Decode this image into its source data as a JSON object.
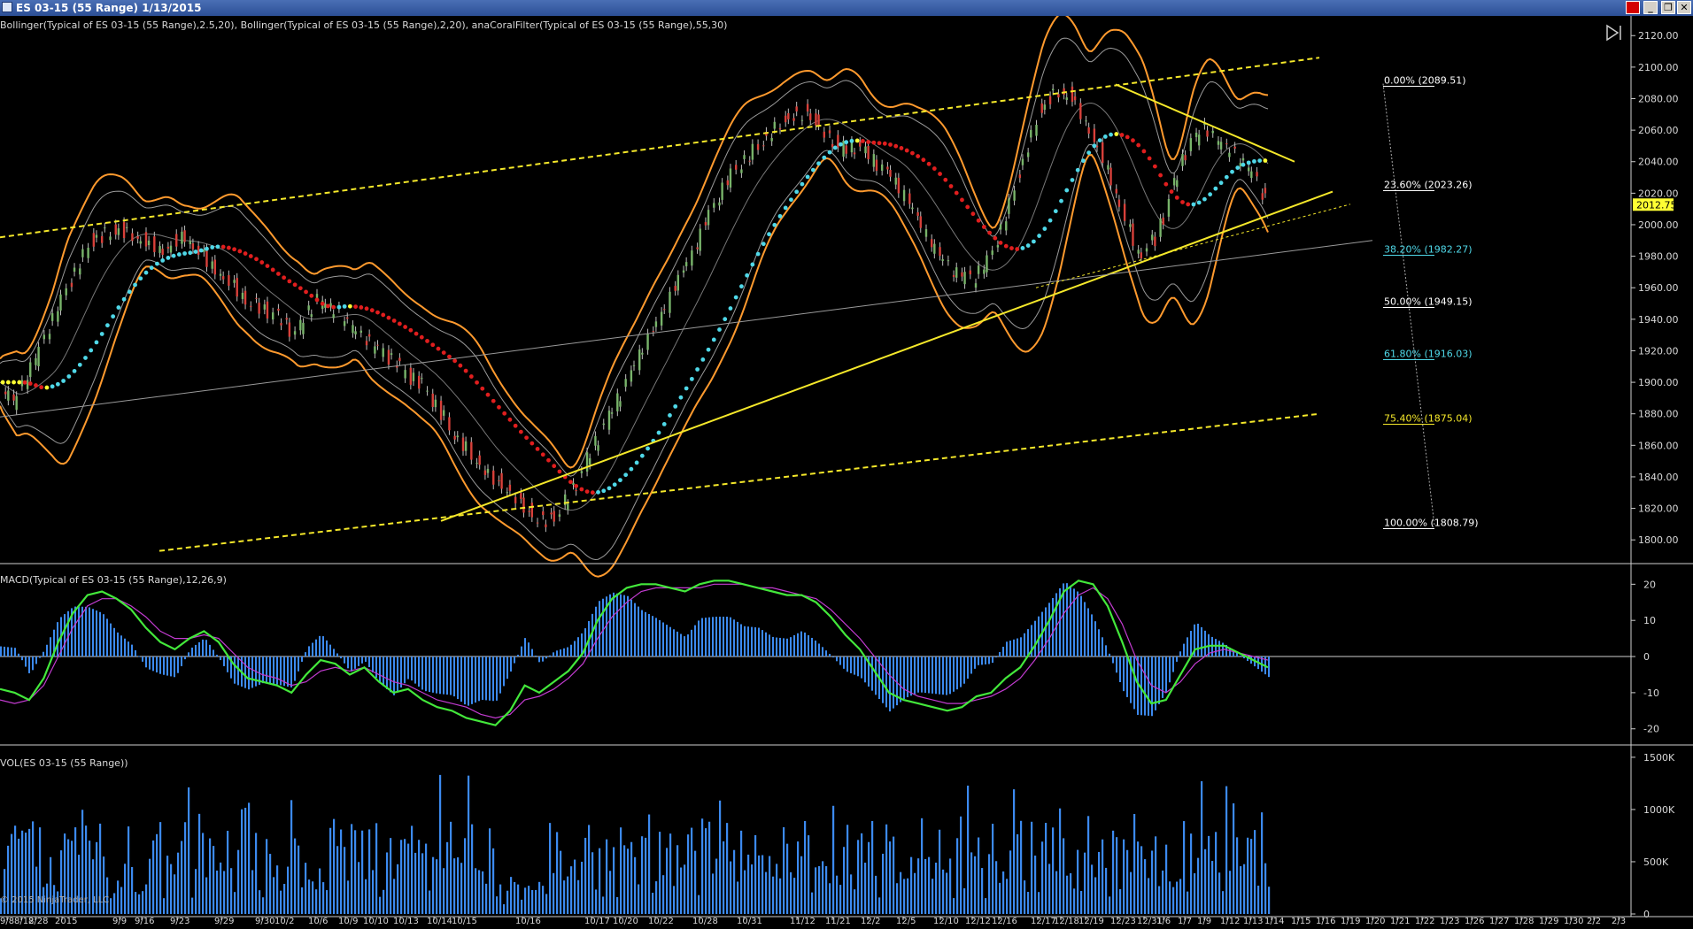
{
  "window": {
    "title": "ES 03-15 (55 Range)  1/13/2015",
    "close_label": "✕",
    "restore_label": "❐",
    "minimize_label": "_"
  },
  "panels": {
    "price_label": "Bollinger(Typical of ES 03-15 (55 Range),2.5,20), Bollinger(Typical of ES 03-15 (55 Range),2,20), anaCoralFilter(Typical of ES 03-15 (55 Range),55,30)",
    "macd_label": "MACD(Typical of ES 03-15 (55 Range),12,26,9)",
    "volume_label": "VOL(ES 03-15 (55 Range))",
    "copyright": "© 2015 NinjaTrader, LLC"
  },
  "colors": {
    "background": "#000000",
    "bollinger_outer": "#ff9a2e",
    "bollinger_inner": "#9a9a9a",
    "coral_up": "#4fd8e8",
    "coral_down": "#e01e1e",
    "coral_flat": "#ffff33",
    "channel": "#f5e82a",
    "candle_up": "#78b46a",
    "candle_down": "#d8403a",
    "macd_line": "#43e83b",
    "signal_line": "#c23bd0",
    "histogram": "#3c8af0",
    "volume": "#3c8af0",
    "last_price_box": "#ffff33"
  },
  "chart_data": [
    {
      "type": "line",
      "title": "",
      "series_name": "ES 03-15 (55 Range)",
      "ylim": [
        1790,
        2128
      ],
      "y_ticks": [
        1800,
        1820,
        1840,
        1860,
        1880,
        1900,
        1920,
        1940,
        1960,
        1980,
        2000,
        2020,
        2040,
        2060,
        2080,
        2100,
        2120
      ],
      "last_price": "2012.75",
      "bar_count": 290,
      "price_path": [
        [
          0,
          1900
        ],
        [
          6,
          1886
        ],
        [
          14,
          1915
        ],
        [
          24,
          1955
        ],
        [
          34,
          1990
        ],
        [
          44,
          1998
        ],
        [
          52,
          1992
        ],
        [
          60,
          1985
        ],
        [
          68,
          1994
        ],
        [
          76,
          1978
        ],
        [
          84,
          1965
        ],
        [
          92,
          1950
        ],
        [
          100,
          1944
        ],
        [
          108,
          1930
        ],
        [
          116,
          1952
        ],
        [
          124,
          1942
        ],
        [
          132,
          1928
        ],
        [
          140,
          1918
        ],
        [
          148,
          1906
        ],
        [
          156,
          1895
        ],
        [
          164,
          1872
        ],
        [
          172,
          1855
        ],
        [
          180,
          1840
        ],
        [
          186,
          1832
        ],
        [
          192,
          1820
        ],
        [
          198,
          1812
        ],
        [
          204,
          1818
        ],
        [
          210,
          1836
        ],
        [
          216,
          1858
        ],
        [
          222,
          1878
        ],
        [
          228,
          1898
        ],
        [
          234,
          1920
        ],
        [
          240,
          1938
        ],
        [
          246,
          1960
        ],
        [
          252,
          1980
        ],
        [
          258,
          2005
        ],
        [
          264,
          2026
        ],
        [
          270,
          2040
        ],
        [
          276,
          2050
        ],
        [
          282,
          2062
        ],
        [
          288,
          2070
        ],
        [
          294,
          2072
        ],
        [
          300,
          2060
        ],
        [
          306,
          2048
        ],
        [
          312,
          2050
        ],
        [
          318,
          2040
        ],
        [
          324,
          2030
        ],
        [
          330,
          2015
        ],
        [
          336,
          1995
        ],
        [
          342,
          1978
        ],
        [
          348,
          1968
        ],
        [
          354,
          1965
        ],
        [
          360,
          1978
        ],
        [
          366,
          2006
        ],
        [
          372,
          2040
        ],
        [
          378,
          2072
        ],
        [
          384,
          2086
        ],
        [
          390,
          2082
        ],
        [
          396,
          2062
        ],
        [
          402,
          2040
        ],
        [
          408,
          2010
        ],
        [
          414,
          1982
        ],
        [
          420,
          1990
        ],
        [
          426,
          2020
        ],
        [
          432,
          2050
        ],
        [
          438,
          2060
        ],
        [
          444,
          2050
        ],
        [
          450,
          2042
        ],
        [
          456,
          2030
        ],
        [
          460,
          2015
        ]
      ],
      "fibonacci": [
        {
          "label": "0.00% (2089.51)",
          "value": 2089.51,
          "color": "#ffffff"
        },
        {
          "label": "23.60% (2023.26)",
          "value": 2023.26,
          "color": "#ffffff"
        },
        {
          "label": "38.20% (1982.27)",
          "value": 1982.27,
          "color": "#4fd8e8"
        },
        {
          "label": "50.00% (1949.15)",
          "value": 1949.15,
          "color": "#ffffff"
        },
        {
          "label": "61.80% (1916.03)",
          "value": 1916.03,
          "color": "#4fd8e8"
        },
        {
          "label": "75.40% (1875.04)",
          "value": 1875.04,
          "color": "#f5e82a"
        },
        {
          "label": "100.00% (1808.79)",
          "value": 1808.79,
          "color": "#ffffff"
        }
      ],
      "trendlines": [
        {
          "name": "upper-channel",
          "from": [
            0,
            1992
          ],
          "to": [
            1490,
            2106
          ],
          "style": "dashed"
        },
        {
          "name": "lower-channel",
          "from": [
            180,
            1793
          ],
          "to": [
            1490,
            1880
          ],
          "style": "dashed"
        },
        {
          "name": "support-trendline",
          "from": [
            498,
            1812
          ],
          "to": [
            1505,
            2021
          ],
          "style": "solid"
        },
        {
          "name": "resistance-trendline",
          "from": [
            1260,
            2089
          ],
          "to": [
            1462,
            2040
          ],
          "style": "solid"
        },
        {
          "name": "mid-channel-grey",
          "from": [
            0,
            1878
          ],
          "to": [
            1550,
            1990
          ],
          "style": "thin"
        },
        {
          "name": "secondary-support",
          "from": [
            1170,
            1960
          ],
          "to": [
            1525,
            2013
          ],
          "style": "thin-dashed"
        }
      ]
    },
    {
      "type": "line",
      "title": "",
      "ylim": [
        -23,
        24
      ],
      "y_ticks": [
        20,
        10,
        0,
        -10,
        -20
      ],
      "series": [
        {
          "name": "MACD",
          "values": [
            -9,
            -10,
            -12,
            -6,
            4,
            12,
            17,
            18,
            16,
            13,
            8,
            4,
            2,
            5,
            7,
            4,
            -2,
            -6,
            -7,
            -8,
            -10,
            -5,
            -1,
            -2,
            -5,
            -3,
            -7,
            -10,
            -9,
            -12,
            -14,
            -15,
            -17,
            -18,
            -19,
            -15,
            -8,
            -10,
            -7,
            -4,
            1,
            10,
            16,
            19,
            20,
            20,
            19,
            18,
            20,
            21,
            21,
            20,
            19,
            18,
            17,
            17,
            15,
            11,
            6,
            2,
            -4,
            -10,
            -12,
            -13,
            -14,
            -15,
            -14,
            -11,
            -10,
            -6,
            -3,
            3,
            10,
            18,
            21,
            20,
            14,
            4,
            -7,
            -13,
            -12,
            -5,
            2,
            3,
            3,
            1,
            -1,
            -3
          ]
        },
        {
          "name": "Signal",
          "values": [
            -12,
            -13,
            -12,
            -8,
            0,
            8,
            14,
            16,
            16,
            14,
            11,
            7,
            5,
            5,
            6,
            5,
            1,
            -3,
            -5,
            -6,
            -8,
            -7,
            -4,
            -3,
            -4,
            -3,
            -5,
            -7,
            -8,
            -10,
            -12,
            -13,
            -14,
            -16,
            -17,
            -16,
            -12,
            -11,
            -9,
            -6,
            -2,
            5,
            11,
            15,
            18,
            19,
            19,
            19,
            19,
            20,
            20,
            20,
            19,
            19,
            18,
            17,
            16,
            13,
            9,
            5,
            0,
            -5,
            -9,
            -11,
            -12,
            -13,
            -13,
            -12,
            -11,
            -9,
            -6,
            -1,
            5,
            12,
            17,
            19,
            16,
            9,
            -1,
            -8,
            -10,
            -7,
            -2,
            1,
            2,
            1,
            0,
            -1
          ]
        }
      ],
      "histogram_scale": 0.42
    },
    {
      "type": "bar",
      "title": "",
      "ylim": [
        0,
        1550000
      ],
      "y_ticks": [
        {
          "value": 1500000,
          "label": "1500K"
        },
        {
          "value": 1000000,
          "label": "1000K"
        },
        {
          "value": 500000,
          "label": "500K"
        },
        {
          "value": 0,
          "label": "0"
        }
      ]
    }
  ],
  "x_axis": {
    "labels": [
      {
        "label": "9/8",
        "x": 8
      },
      {
        "label": "8/12",
        "x": 24
      },
      {
        "label": "8/28",
        "x": 40
      },
      {
        "label": "2015",
        "x": 70
      },
      {
        "label": "9/9",
        "x": 135
      },
      {
        "label": "9/16",
        "x": 160
      },
      {
        "label": "9/23",
        "x": 200
      },
      {
        "label": "9/29",
        "x": 250
      },
      {
        "label": "9/30",
        "x": 296
      },
      {
        "label": "10/2",
        "x": 318
      },
      {
        "label": "10/6",
        "x": 356
      },
      {
        "label": "10/9",
        "x": 390
      },
      {
        "label": "10/10",
        "x": 418
      },
      {
        "label": "10/13",
        "x": 452
      },
      {
        "label": "10/14",
        "x": 490
      },
      {
        "label": "10/15",
        "x": 518
      },
      {
        "label": "10/16",
        "x": 590
      },
      {
        "label": "10/17",
        "x": 668
      },
      {
        "label": "10/20",
        "x": 700
      },
      {
        "label": "10/22",
        "x": 740
      },
      {
        "label": "10/28",
        "x": 790
      },
      {
        "label": "10/31",
        "x": 840
      },
      {
        "label": "11/12",
        "x": 900
      },
      {
        "label": "11/21",
        "x": 940
      },
      {
        "label": "12/2",
        "x": 980
      },
      {
        "label": "12/5",
        "x": 1020
      },
      {
        "label": "12/10",
        "x": 1062
      },
      {
        "label": "12/12",
        "x": 1098
      },
      {
        "label": "12/16",
        "x": 1128
      },
      {
        "label": "12/17",
        "x": 1172
      },
      {
        "label": "12/18",
        "x": 1198
      },
      {
        "label": "12/19",
        "x": 1226
      },
      {
        "label": "12/23",
        "x": 1262
      },
      {
        "label": "12/31",
        "x": 1292
      },
      {
        "label": "1/6",
        "x": 1314
      },
      {
        "label": "1/7",
        "x": 1338
      },
      {
        "label": "1/9",
        "x": 1360
      },
      {
        "label": "1/12",
        "x": 1386
      },
      {
        "label": "1/13",
        "x": 1412
      },
      {
        "label": "1/14",
        "x": 1436
      },
      {
        "label": "1/15",
        "x": 1466
      },
      {
        "label": "1/16",
        "x": 1494
      },
      {
        "label": "1/19",
        "x": 1522
      },
      {
        "label": "1/20",
        "x": 1550
      },
      {
        "label": "1/21",
        "x": 1578
      },
      {
        "label": "1/22",
        "x": 1606
      },
      {
        "label": "1/23",
        "x": 1634
      },
      {
        "label": "1/26",
        "x": 1662
      },
      {
        "label": "1/27",
        "x": 1690
      },
      {
        "label": "1/28",
        "x": 1718
      },
      {
        "label": "1/29",
        "x": 1746
      },
      {
        "label": "1/30",
        "x": 1774
      },
      {
        "label": "2/2",
        "x": 1800
      },
      {
        "label": "2/3",
        "x": 1828
      }
    ]
  }
}
